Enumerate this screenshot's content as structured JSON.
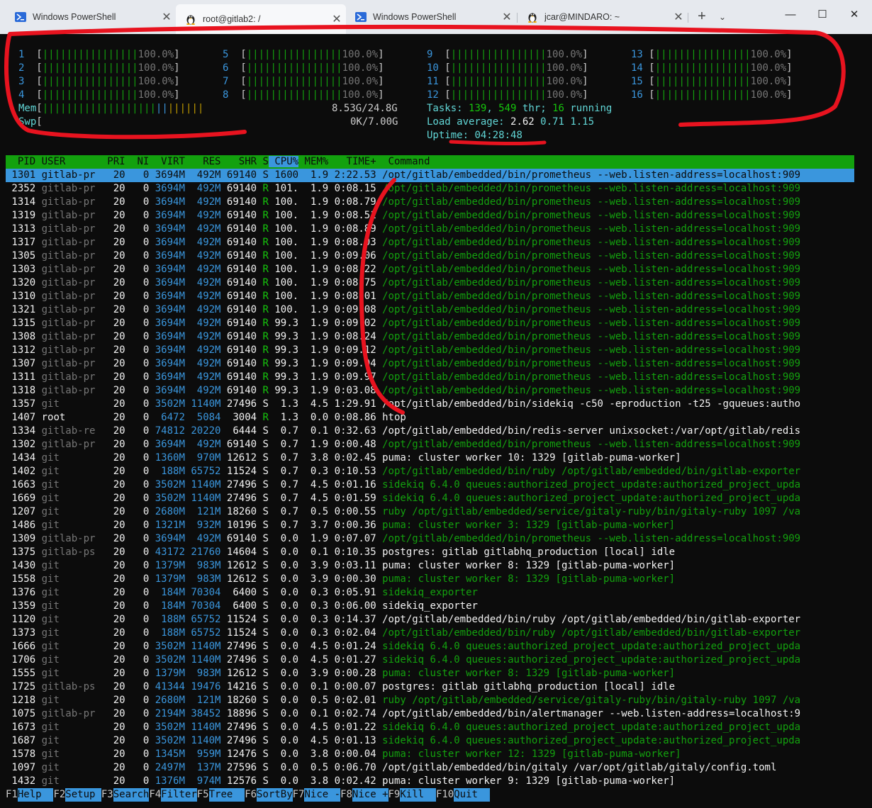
{
  "tabs": [
    {
      "title": "Windows PowerShell",
      "icon": "powershell-icon",
      "active": false
    },
    {
      "title": "root@gitlab2: /",
      "icon": "linux-penguin-icon",
      "active": true
    },
    {
      "title": "Windows PowerShell",
      "icon": "powershell-icon",
      "active": false
    },
    {
      "title": "jcar@MINDARO: ~",
      "icon": "linux-penguin-icon",
      "active": false
    }
  ],
  "new_tab_label": "+",
  "tab_menu_label": "⌄",
  "window_controls": {
    "minimize": "—",
    "maximize": "☐",
    "close": "✕"
  },
  "meters": {
    "cpus": [
      {
        "id": "1",
        "pct": "100.0%"
      },
      {
        "id": "2",
        "pct": "100.0%"
      },
      {
        "id": "3",
        "pct": "100.0%"
      },
      {
        "id": "4",
        "pct": "100.0%"
      },
      {
        "id": "5",
        "pct": "100.0%"
      },
      {
        "id": "6",
        "pct": "100.0%"
      },
      {
        "id": "7",
        "pct": "100.0%"
      },
      {
        "id": "8",
        "pct": "100.0%"
      },
      {
        "id": "9",
        "pct": "100.0%"
      },
      {
        "id": "10",
        "pct": "100.0%"
      },
      {
        "id": "11",
        "pct": "100.0%"
      },
      {
        "id": "12",
        "pct": "100.0%"
      },
      {
        "id": "13",
        "pct": "100.0%"
      },
      {
        "id": "14",
        "pct": "100.0%"
      },
      {
        "id": "15",
        "pct": "100.0%"
      },
      {
        "id": "16",
        "pct": "100.0%"
      }
    ],
    "mem_label": "Mem",
    "mem_value": "8.53G/24.8G",
    "swp_label": "Swp",
    "swp_value": "0K/7.00G",
    "tasks_label": "Tasks:",
    "tasks_count": "139",
    "threads": "549",
    "thr_label": "thr;",
    "running": "16",
    "running_label": "running",
    "load_label": "Load average:",
    "load1": "2.62",
    "load5": "0.71",
    "load15": "1.15",
    "uptime_label": "Uptime:",
    "uptime": "04:28:48"
  },
  "header": {
    "pid": "  PID",
    "user": "USER     ",
    "pri": "  PRI",
    "ni": "  NI",
    "virt": "  VIRT",
    "res": "   RES",
    "shr": "   SHR",
    "s": " S",
    "cpu": " CPU%",
    "mem": "MEM%",
    "time": "   TIME+ ",
    "cmd": " Command"
  },
  "processes": [
    {
      "pid": "1301",
      "user": "gitlab-pr",
      "pri": "20",
      "ni": "0",
      "virt": "3694M",
      "res": "492M",
      "shr": "69140",
      "s": "S",
      "cpu": "1600",
      "mem": "1.9",
      "time": "2:22.53",
      "cmd": "/opt/gitlab/embedded/bin/prometheus --web.listen-address=localhost:909",
      "thread": true
    },
    {
      "pid": "2352",
      "user": "gitlab-pr",
      "pri": "20",
      "ni": "0",
      "virt": "3694M",
      "res": "492M",
      "shr": "69140",
      "s": "R",
      "cpu": "101.",
      "mem": "1.9",
      "time": "0:08.15",
      "cmd": "/opt/gitlab/embedded/bin/prometheus --web.listen-address=localhost:909",
      "thread": true
    },
    {
      "pid": "1314",
      "user": "gitlab-pr",
      "pri": "20",
      "ni": "0",
      "virt": "3694M",
      "res": "492M",
      "shr": "69140",
      "s": "R",
      "cpu": "100.",
      "mem": "1.9",
      "time": "0:08.79",
      "cmd": "/opt/gitlab/embedded/bin/prometheus --web.listen-address=localhost:909",
      "thread": true
    },
    {
      "pid": "1319",
      "user": "gitlab-pr",
      "pri": "20",
      "ni": "0",
      "virt": "3694M",
      "res": "492M",
      "shr": "69140",
      "s": "R",
      "cpu": "100.",
      "mem": "1.9",
      "time": "0:08.51",
      "cmd": "/opt/gitlab/embedded/bin/prometheus --web.listen-address=localhost:909",
      "thread": true
    },
    {
      "pid": "1313",
      "user": "gitlab-pr",
      "pri": "20",
      "ni": "0",
      "virt": "3694M",
      "res": "492M",
      "shr": "69140",
      "s": "R",
      "cpu": "100.",
      "mem": "1.9",
      "time": "0:08.89",
      "cmd": "/opt/gitlab/embedded/bin/prometheus --web.listen-address=localhost:909",
      "thread": true
    },
    {
      "pid": "1317",
      "user": "gitlab-pr",
      "pri": "20",
      "ni": "0",
      "virt": "3694M",
      "res": "492M",
      "shr": "69140",
      "s": "R",
      "cpu": "100.",
      "mem": "1.9",
      "time": "0:08.03",
      "cmd": "/opt/gitlab/embedded/bin/prometheus --web.listen-address=localhost:909",
      "thread": true
    },
    {
      "pid": "1305",
      "user": "gitlab-pr",
      "pri": "20",
      "ni": "0",
      "virt": "3694M",
      "res": "492M",
      "shr": "69140",
      "s": "R",
      "cpu": "100.",
      "mem": "1.9",
      "time": "0:09.06",
      "cmd": "/opt/gitlab/embedded/bin/prometheus --web.listen-address=localhost:909",
      "thread": true
    },
    {
      "pid": "1303",
      "user": "gitlab-pr",
      "pri": "20",
      "ni": "0",
      "virt": "3694M",
      "res": "492M",
      "shr": "69140",
      "s": "R",
      "cpu": "100.",
      "mem": "1.9",
      "time": "0:08.22",
      "cmd": "/opt/gitlab/embedded/bin/prometheus --web.listen-address=localhost:909",
      "thread": true
    },
    {
      "pid": "1320",
      "user": "gitlab-pr",
      "pri": "20",
      "ni": "0",
      "virt": "3694M",
      "res": "492M",
      "shr": "69140",
      "s": "R",
      "cpu": "100.",
      "mem": "1.9",
      "time": "0:08.75",
      "cmd": "/opt/gitlab/embedded/bin/prometheus --web.listen-address=localhost:909",
      "thread": true
    },
    {
      "pid": "1310",
      "user": "gitlab-pr",
      "pri": "20",
      "ni": "0",
      "virt": "3694M",
      "res": "492M",
      "shr": "69140",
      "s": "R",
      "cpu": "100.",
      "mem": "1.9",
      "time": "0:08.01",
      "cmd": "/opt/gitlab/embedded/bin/prometheus --web.listen-address=localhost:909",
      "thread": true
    },
    {
      "pid": "1321",
      "user": "gitlab-pr",
      "pri": "20",
      "ni": "0",
      "virt": "3694M",
      "res": "492M",
      "shr": "69140",
      "s": "R",
      "cpu": "100.",
      "mem": "1.9",
      "time": "0:09.08",
      "cmd": "/opt/gitlab/embedded/bin/prometheus --web.listen-address=localhost:909",
      "thread": true
    },
    {
      "pid": "1315",
      "user": "gitlab-pr",
      "pri": "20",
      "ni": "0",
      "virt": "3694M",
      "res": "492M",
      "shr": "69140",
      "s": "R",
      "cpu": "99.3",
      "mem": "1.9",
      "time": "0:09.02",
      "cmd": "/opt/gitlab/embedded/bin/prometheus --web.listen-address=localhost:909",
      "thread": true
    },
    {
      "pid": "1308",
      "user": "gitlab-pr",
      "pri": "20",
      "ni": "0",
      "virt": "3694M",
      "res": "492M",
      "shr": "69140",
      "s": "R",
      "cpu": "99.3",
      "mem": "1.9",
      "time": "0:08.24",
      "cmd": "/opt/gitlab/embedded/bin/prometheus --web.listen-address=localhost:909",
      "thread": true
    },
    {
      "pid": "1312",
      "user": "gitlab-pr",
      "pri": "20",
      "ni": "0",
      "virt": "3694M",
      "res": "492M",
      "shr": "69140",
      "s": "R",
      "cpu": "99.3",
      "mem": "1.9",
      "time": "0:09.12",
      "cmd": "/opt/gitlab/embedded/bin/prometheus --web.listen-address=localhost:909",
      "thread": true
    },
    {
      "pid": "1307",
      "user": "gitlab-pr",
      "pri": "20",
      "ni": "0",
      "virt": "3694M",
      "res": "492M",
      "shr": "69140",
      "s": "R",
      "cpu": "99.3",
      "mem": "1.9",
      "time": "0:09.04",
      "cmd": "/opt/gitlab/embedded/bin/prometheus --web.listen-address=localhost:909",
      "thread": true
    },
    {
      "pid": "1311",
      "user": "gitlab-pr",
      "pri": "20",
      "ni": "0",
      "virt": "3694M",
      "res": "492M",
      "shr": "69140",
      "s": "R",
      "cpu": "99.3",
      "mem": "1.9",
      "time": "0:09.97",
      "cmd": "/opt/gitlab/embedded/bin/prometheus --web.listen-address=localhost:909",
      "thread": true
    },
    {
      "pid": "1318",
      "user": "gitlab-pr",
      "pri": "20",
      "ni": "0",
      "virt": "3694M",
      "res": "492M",
      "shr": "69140",
      "s": "R",
      "cpu": "99.3",
      "mem": "1.9",
      "time": "0:03.08",
      "cmd": "/opt/gitlab/embedded/bin/prometheus --web.listen-address=localhost:909",
      "thread": true
    },
    {
      "pid": "1357",
      "user": "git",
      "pri": "20",
      "ni": "0",
      "virt": "3502M",
      "res": "1140M",
      "shr": "27496",
      "s": "S",
      "cpu": "1.3",
      "mem": "4.5",
      "time": "1:29.91",
      "cmd": "/opt/gitlab/embedded/bin/sidekiq -c50 -eproduction -t25 -gqueues:autho",
      "thread": false
    },
    {
      "pid": "1407",
      "user": "root",
      "pri": "20",
      "ni": "0",
      "virt": "6472",
      "res": "5084",
      "shr": "3004",
      "s": "R",
      "cpu": "1.3",
      "mem": "0.0",
      "time": "0:08.86",
      "cmd": "htop",
      "thread": false,
      "root": true
    },
    {
      "pid": "1334",
      "user": "gitlab-re",
      "pri": "20",
      "ni": "0",
      "virt": "74812",
      "res": "20220",
      "shr": "6444",
      "s": "S",
      "cpu": "0.7",
      "mem": "0.1",
      "time": "0:32.63",
      "cmd": "/opt/gitlab/embedded/bin/redis-server unixsocket:/var/opt/gitlab/redis",
      "thread": false
    },
    {
      "pid": "1302",
      "user": "gitlab-pr",
      "pri": "20",
      "ni": "0",
      "virt": "3694M",
      "res": "492M",
      "shr": "69140",
      "s": "S",
      "cpu": "0.7",
      "mem": "1.9",
      "time": "0:00.48",
      "cmd": "/opt/gitlab/embedded/bin/prometheus --web.listen-address=localhost:909",
      "thread": true
    },
    {
      "pid": "1434",
      "user": "git",
      "pri": "20",
      "ni": "0",
      "virt": "1360M",
      "res": "970M",
      "shr": "12612",
      "s": "S",
      "cpu": "0.7",
      "mem": "3.8",
      "time": "0:02.45",
      "cmd": "puma: cluster worker 10: 1329 [gitlab-puma-worker]",
      "thread": false
    },
    {
      "pid": "1402",
      "user": "git",
      "pri": "20",
      "ni": "0",
      "virt": "188M",
      "res": "65752",
      "shr": "11524",
      "s": "S",
      "cpu": "0.7",
      "mem": "0.3",
      "time": "0:10.53",
      "cmd": "/opt/gitlab/embedded/bin/ruby /opt/gitlab/embedded/bin/gitlab-exporter",
      "thread": true
    },
    {
      "pid": "1663",
      "user": "git",
      "pri": "20",
      "ni": "0",
      "virt": "3502M",
      "res": "1140M",
      "shr": "27496",
      "s": "S",
      "cpu": "0.7",
      "mem": "4.5",
      "time": "0:01.16",
      "cmd": "sidekiq 6.4.0 queues:authorized_project_update:authorized_project_upda",
      "thread": true
    },
    {
      "pid": "1669",
      "user": "git",
      "pri": "20",
      "ni": "0",
      "virt": "3502M",
      "res": "1140M",
      "shr": "27496",
      "s": "S",
      "cpu": "0.7",
      "mem": "4.5",
      "time": "0:01.59",
      "cmd": "sidekiq 6.4.0 queues:authorized_project_update:authorized_project_upda",
      "thread": true
    },
    {
      "pid": "1207",
      "user": "git",
      "pri": "20",
      "ni": "0",
      "virt": "2680M",
      "res": "121M",
      "shr": "18260",
      "s": "S",
      "cpu": "0.7",
      "mem": "0.5",
      "time": "0:00.55",
      "cmd": "ruby /opt/gitlab/embedded/service/gitaly-ruby/bin/gitaly-ruby 1097 /va",
      "thread": true
    },
    {
      "pid": "1486",
      "user": "git",
      "pri": "20",
      "ni": "0",
      "virt": "1321M",
      "res": "932M",
      "shr": "10196",
      "s": "S",
      "cpu": "0.7",
      "mem": "3.7",
      "time": "0:00.36",
      "cmd": "puma: cluster worker 3: 1329 [gitlab-puma-worker]",
      "thread": true
    },
    {
      "pid": "1309",
      "user": "gitlab-pr",
      "pri": "20",
      "ni": "0",
      "virt": "3694M",
      "res": "492M",
      "shr": "69140",
      "s": "S",
      "cpu": "0.0",
      "mem": "1.9",
      "time": "0:07.07",
      "cmd": "/opt/gitlab/embedded/bin/prometheus --web.listen-address=localhost:909",
      "thread": true
    },
    {
      "pid": "1375",
      "user": "gitlab-ps",
      "pri": "20",
      "ni": "0",
      "virt": "43172",
      "res": "21760",
      "shr": "14604",
      "s": "S",
      "cpu": "0.0",
      "mem": "0.1",
      "time": "0:10.35",
      "cmd": "postgres: gitlab gitlabhq_production [local] idle",
      "thread": false
    },
    {
      "pid": "1430",
      "user": "git",
      "pri": "20",
      "ni": "0",
      "virt": "1379M",
      "res": "983M",
      "shr": "12612",
      "s": "S",
      "cpu": "0.0",
      "mem": "3.9",
      "time": "0:03.11",
      "cmd": "puma: cluster worker 8: 1329 [gitlab-puma-worker]",
      "thread": false
    },
    {
      "pid": "1558",
      "user": "git",
      "pri": "20",
      "ni": "0",
      "virt": "1379M",
      "res": "983M",
      "shr": "12612",
      "s": "S",
      "cpu": "0.0",
      "mem": "3.9",
      "time": "0:00.30",
      "cmd": "puma: cluster worker 8: 1329 [gitlab-puma-worker]",
      "thread": true
    },
    {
      "pid": "1376",
      "user": "git",
      "pri": "20",
      "ni": "0",
      "virt": "184M",
      "res": "70304",
      "shr": "6400",
      "s": "S",
      "cpu": "0.0",
      "mem": "0.3",
      "time": "0:05.91",
      "cmd": "sidekiq_exporter",
      "thread": true
    },
    {
      "pid": "1359",
      "user": "git",
      "pri": "20",
      "ni": "0",
      "virt": "184M",
      "res": "70304",
      "shr": "6400",
      "s": "S",
      "cpu": "0.0",
      "mem": "0.3",
      "time": "0:06.00",
      "cmd": "sidekiq_exporter",
      "thread": false
    },
    {
      "pid": "1120",
      "user": "git",
      "pri": "20",
      "ni": "0",
      "virt": "188M",
      "res": "65752",
      "shr": "11524",
      "s": "S",
      "cpu": "0.0",
      "mem": "0.3",
      "time": "0:14.37",
      "cmd": "/opt/gitlab/embedded/bin/ruby /opt/gitlab/embedded/bin/gitlab-exporter",
      "thread": false
    },
    {
      "pid": "1373",
      "user": "git",
      "pri": "20",
      "ni": "0",
      "virt": "188M",
      "res": "65752",
      "shr": "11524",
      "s": "S",
      "cpu": "0.0",
      "mem": "0.3",
      "time": "0:02.04",
      "cmd": "/opt/gitlab/embedded/bin/ruby /opt/gitlab/embedded/bin/gitlab-exporter",
      "thread": true
    },
    {
      "pid": "1666",
      "user": "git",
      "pri": "20",
      "ni": "0",
      "virt": "3502M",
      "res": "1140M",
      "shr": "27496",
      "s": "S",
      "cpu": "0.0",
      "mem": "4.5",
      "time": "0:01.24",
      "cmd": "sidekiq 6.4.0 queues:authorized_project_update:authorized_project_upda",
      "thread": true
    },
    {
      "pid": "1706",
      "user": "git",
      "pri": "20",
      "ni": "0",
      "virt": "3502M",
      "res": "1140M",
      "shr": "27496",
      "s": "S",
      "cpu": "0.0",
      "mem": "4.5",
      "time": "0:01.27",
      "cmd": "sidekiq 6.4.0 queues:authorized_project_update:authorized_project_upda",
      "thread": true
    },
    {
      "pid": "1555",
      "user": "git",
      "pri": "20",
      "ni": "0",
      "virt": "1379M",
      "res": "983M",
      "shr": "12612",
      "s": "S",
      "cpu": "0.0",
      "mem": "3.9",
      "time": "0:00.28",
      "cmd": "puma: cluster worker 8: 1329 [gitlab-puma-worker]",
      "thread": true
    },
    {
      "pid": "1725",
      "user": "gitlab-ps",
      "pri": "20",
      "ni": "0",
      "virt": "41344",
      "res": "19476",
      "shr": "14216",
      "s": "S",
      "cpu": "0.0",
      "mem": "0.1",
      "time": "0:00.07",
      "cmd": "postgres: gitlab gitlabhq_production [local] idle",
      "thread": false
    },
    {
      "pid": "1218",
      "user": "git",
      "pri": "20",
      "ni": "0",
      "virt": "2680M",
      "res": "121M",
      "shr": "18260",
      "s": "S",
      "cpu": "0.0",
      "mem": "0.5",
      "time": "0:02.01",
      "cmd": "ruby /opt/gitlab/embedded/service/gitaly-ruby/bin/gitaly-ruby 1097 /va",
      "thread": true
    },
    {
      "pid": "1075",
      "user": "gitlab-pr",
      "pri": "20",
      "ni": "0",
      "virt": "2194M",
      "res": "38452",
      "shr": "18896",
      "s": "S",
      "cpu": "0.0",
      "mem": "0.1",
      "time": "0:02.74",
      "cmd": "/opt/gitlab/embedded/bin/alertmanager --web.listen-address=localhost:9",
      "thread": false
    },
    {
      "pid": "1673",
      "user": "git",
      "pri": "20",
      "ni": "0",
      "virt": "3502M",
      "res": "1140M",
      "shr": "27496",
      "s": "S",
      "cpu": "0.0",
      "mem": "4.5",
      "time": "0:01.22",
      "cmd": "sidekiq 6.4.0 queues:authorized_project_update:authorized_project_upda",
      "thread": true
    },
    {
      "pid": "1687",
      "user": "git",
      "pri": "20",
      "ni": "0",
      "virt": "3502M",
      "res": "1140M",
      "shr": "27496",
      "s": "S",
      "cpu": "0.0",
      "mem": "4.5",
      "time": "0:01.13",
      "cmd": "sidekiq 6.4.0 queues:authorized_project_update:authorized_project_upda",
      "thread": true
    },
    {
      "pid": "1578",
      "user": "git",
      "pri": "20",
      "ni": "0",
      "virt": "1345M",
      "res": "959M",
      "shr": "12476",
      "s": "S",
      "cpu": "0.0",
      "mem": "3.8",
      "time": "0:00.04",
      "cmd": "puma: cluster worker 12: 1329 [gitlab-puma-worker]",
      "thread": true
    },
    {
      "pid": "1097",
      "user": "git",
      "pri": "20",
      "ni": "0",
      "virt": "2497M",
      "res": "137M",
      "shr": "27596",
      "s": "S",
      "cpu": "0.0",
      "mem": "0.5",
      "time": "0:06.70",
      "cmd": "/opt/gitlab/embedded/bin/gitaly /var/opt/gitlab/gitaly/config.toml",
      "thread": false
    },
    {
      "pid": "1432",
      "user": "git",
      "pri": "20",
      "ni": "0",
      "virt": "1376M",
      "res": "974M",
      "shr": "12576",
      "s": "S",
      "cpu": "0.0",
      "mem": "3.8",
      "time": "0:02.42",
      "cmd": "puma: cluster worker 9: 1329 [gitlab-puma-worker]",
      "thread": false
    }
  ],
  "footer": [
    {
      "key": "F1",
      "action": "Help  "
    },
    {
      "key": "F2",
      "action": "Setup "
    },
    {
      "key": "F3",
      "action": "Search"
    },
    {
      "key": "F4",
      "action": "Filter"
    },
    {
      "key": "F5",
      "action": "Tree  "
    },
    {
      "key": "F6",
      "action": "SortBy"
    },
    {
      "key": "F7",
      "action": "Nice -"
    },
    {
      "key": "F8",
      "action": "Nice +"
    },
    {
      "key": "F9",
      "action": "Kill  "
    },
    {
      "key": "F10",
      "action": "Quit  "
    }
  ],
  "colors": {
    "terminal_bg": "#0c0c0c",
    "header_green": "#13a10e",
    "select_blue": "#3a96dd",
    "annotation_red": "#e8131f"
  }
}
